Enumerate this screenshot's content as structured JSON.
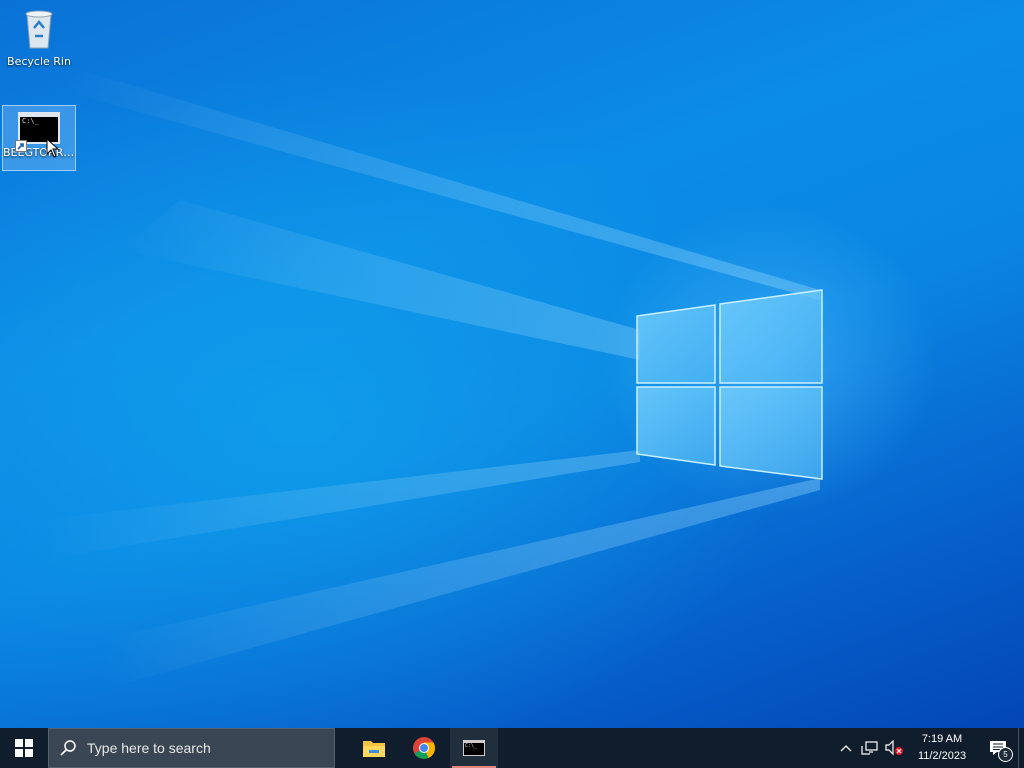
{
  "desktop": {
    "icons": [
      {
        "label": "Becycle Rin",
        "icon": "recycle-bin-icon"
      },
      {
        "label": "BEEGTORRE...",
        "icon": "command-prompt-icon",
        "selected": true
      }
    ],
    "wallpaper": "windows-10-hero",
    "colors": {
      "accent": "#0a86e2",
      "taskbar": "#0f1d2c"
    }
  },
  "taskbar": {
    "search": {
      "placeholder": "Type here to search"
    },
    "pinned": [
      {
        "name": "File Explorer",
        "icon": "folder-icon"
      },
      {
        "name": "Google Chrome",
        "icon": "chrome-icon"
      },
      {
        "name": "Command Prompt",
        "icon": "cmd-icon",
        "active": true
      }
    ],
    "cmd_icon_text": "C:\\_",
    "tray": {
      "time": "7:19 AM",
      "date": "11/2/2023",
      "notification_count": "5"
    }
  }
}
